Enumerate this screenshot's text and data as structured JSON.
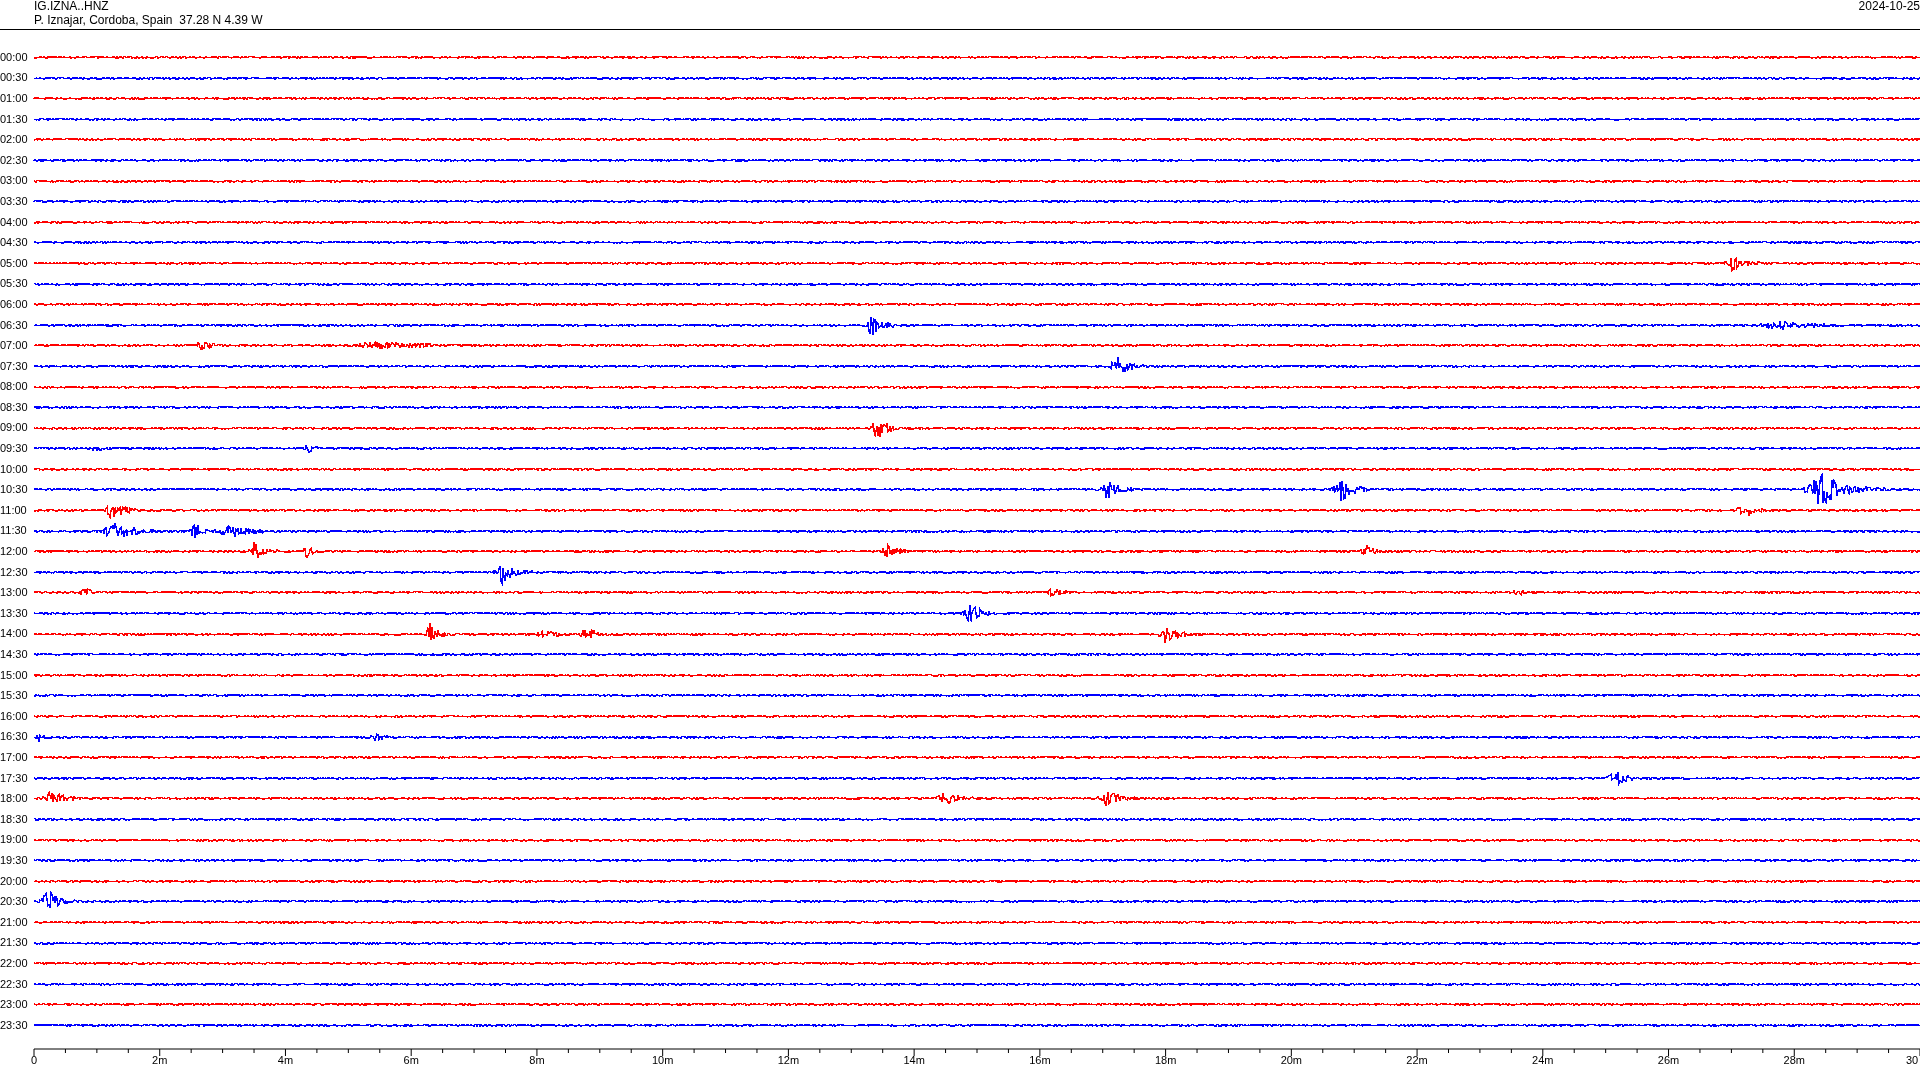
{
  "header": {
    "station": "IG.IZNA..HNZ",
    "location": "P. Iznajar, Cordoba, Spain  37.28 N 4.39 W",
    "date": "2024-10-25"
  },
  "rows": [
    {
      "time": "00:00",
      "color": "#ff0000"
    },
    {
      "time": "00:30",
      "color": "#0000ff"
    },
    {
      "time": "01:00",
      "color": "#ff0000"
    },
    {
      "time": "01:30",
      "color": "#0000ff"
    },
    {
      "time": "02:00",
      "color": "#ff0000"
    },
    {
      "time": "02:30",
      "color": "#0000ff"
    },
    {
      "time": "03:00",
      "color": "#ff0000"
    },
    {
      "time": "03:30",
      "color": "#0000ff"
    },
    {
      "time": "04:00",
      "color": "#ff0000"
    },
    {
      "time": "04:30",
      "color": "#0000ff"
    },
    {
      "time": "05:00",
      "color": "#ff0000"
    },
    {
      "time": "05:30",
      "color": "#0000ff"
    },
    {
      "time": "06:00",
      "color": "#ff0000"
    },
    {
      "time": "06:30",
      "color": "#0000ff"
    },
    {
      "time": "07:00",
      "color": "#ff0000"
    },
    {
      "time": "07:30",
      "color": "#0000ff"
    },
    {
      "time": "08:00",
      "color": "#ff0000"
    },
    {
      "time": "08:30",
      "color": "#0000ff"
    },
    {
      "time": "09:00",
      "color": "#ff0000"
    },
    {
      "time": "09:30",
      "color": "#0000ff"
    },
    {
      "time": "10:00",
      "color": "#ff0000"
    },
    {
      "time": "10:30",
      "color": "#0000ff"
    },
    {
      "time": "11:00",
      "color": "#ff0000"
    },
    {
      "time": "11:30",
      "color": "#0000ff"
    },
    {
      "time": "12:00",
      "color": "#ff0000"
    },
    {
      "time": "12:30",
      "color": "#0000ff"
    },
    {
      "time": "13:00",
      "color": "#ff0000"
    },
    {
      "time": "13:30",
      "color": "#0000ff"
    },
    {
      "time": "14:00",
      "color": "#ff0000"
    },
    {
      "time": "14:30",
      "color": "#0000ff"
    },
    {
      "time": "15:00",
      "color": "#ff0000"
    },
    {
      "time": "15:30",
      "color": "#0000ff"
    },
    {
      "time": "16:00",
      "color": "#ff0000"
    },
    {
      "time": "16:30",
      "color": "#0000ff"
    },
    {
      "time": "17:00",
      "color": "#ff0000"
    },
    {
      "time": "17:30",
      "color": "#0000ff"
    },
    {
      "time": "18:00",
      "color": "#ff0000"
    },
    {
      "time": "18:30",
      "color": "#0000ff"
    },
    {
      "time": "19:00",
      "color": "#ff0000"
    },
    {
      "time": "19:30",
      "color": "#0000ff"
    },
    {
      "time": "20:00",
      "color": "#ff0000"
    },
    {
      "time": "20:30",
      "color": "#0000ff"
    },
    {
      "time": "21:00",
      "color": "#ff0000"
    },
    {
      "time": "21:30",
      "color": "#0000ff"
    },
    {
      "time": "22:00",
      "color": "#ff0000"
    },
    {
      "time": "22:30",
      "color": "#0000ff"
    },
    {
      "time": "23:00",
      "color": "#ff0000"
    },
    {
      "time": "23:30",
      "color": "#0000ff"
    }
  ],
  "x_axis": {
    "labels": [
      "0",
      "2m",
      "4m",
      "6m",
      "8m",
      "10m",
      "12m",
      "14m",
      "16m",
      "18m",
      "20m",
      "22m",
      "24m",
      "26m",
      "28m",
      "30"
    ]
  }
}
